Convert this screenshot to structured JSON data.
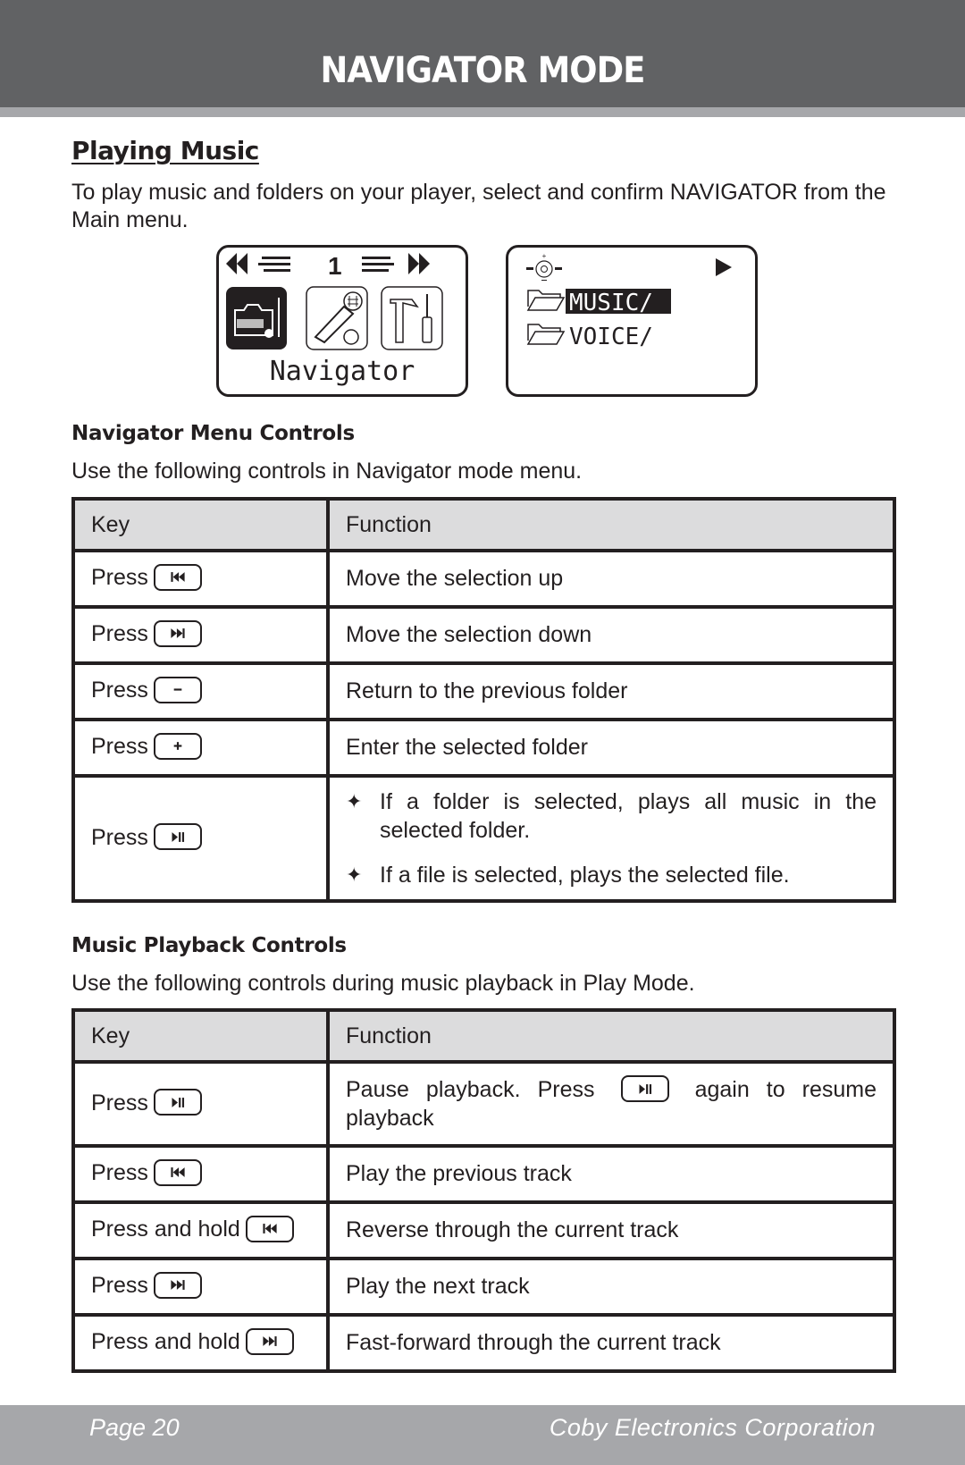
{
  "header": {
    "title": "NAVIGATOR MODE"
  },
  "section": {
    "title": "Playing Music",
    "intro": "To play music and folders on your player, select and confirm NAVIGATOR from the Main menu."
  },
  "screens": {
    "main_menu": {
      "page_number": "1",
      "label": "Navigator",
      "icons": [
        "navigator-icon",
        "record-icon",
        "settings-icon"
      ],
      "selected_icon": "navigator-icon"
    },
    "navigator": {
      "folders": [
        {
          "name": "MUSIC/",
          "selected": true
        },
        {
          "name": "VOICE/",
          "selected": false
        }
      ],
      "status_icon": "play-icon"
    }
  },
  "navigator_controls": {
    "heading": "Navigator Menu Controls",
    "description": "Use the following controls in Navigator mode menu.",
    "columns": [
      "Key",
      "Function"
    ],
    "rows": [
      {
        "key_label": "Press",
        "key_icon": "prev-icon",
        "function": "Move the selection up"
      },
      {
        "key_label": "Press",
        "key_icon": "next-icon",
        "function": "Move the selection down"
      },
      {
        "key_label": "Press",
        "key_icon": "minus-icon",
        "function": "Return to the previous folder"
      },
      {
        "key_label": "Press",
        "key_icon": "plus-icon",
        "function": "Enter the selected folder"
      },
      {
        "key_label": "Press",
        "key_icon": "play-pause-icon",
        "function_bullets": [
          "If a folder is selected, plays all music in the selected folder.",
          "If a file is selected, plays the selected file."
        ]
      }
    ]
  },
  "playback_controls": {
    "heading": "Music Playback Controls",
    "description": "Use the following controls during music playback in Play Mode.",
    "columns": [
      "Key",
      "Function"
    ],
    "rows": [
      {
        "key_label": "Press",
        "key_icon": "play-pause-icon",
        "function_pre": "Pause playback. Press",
        "function_icon": "play-pause-icon",
        "function_post": "again to resume playback"
      },
      {
        "key_label": "Press",
        "key_icon": "prev-icon",
        "function": "Play the previous track"
      },
      {
        "key_label": "Press and hold",
        "key_icon": "prev-icon",
        "function": "Reverse through the current track"
      },
      {
        "key_label": "Press",
        "key_icon": "next-icon",
        "function": "Play the next track"
      },
      {
        "key_label": "Press and hold",
        "key_icon": "next-icon",
        "function": "Fast-forward through the current track"
      }
    ]
  },
  "footer": {
    "page": "Page 20",
    "company": "Coby Electronics Corporation"
  }
}
